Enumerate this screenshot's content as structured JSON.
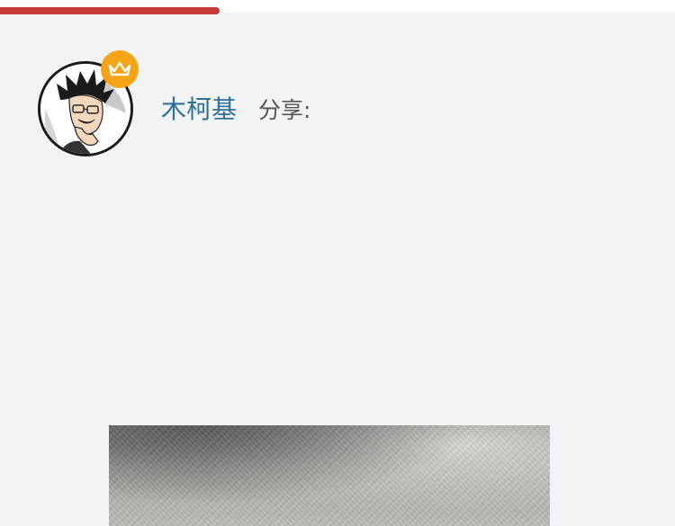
{
  "reading_progress": {
    "fraction": 0.325,
    "color": "#c83a3a"
  },
  "author": {
    "name": "木柯基",
    "share_label": "分享:",
    "name_color": "#2f6f9a",
    "avatar_icon": "manga-portrait-avatar",
    "badge_icon": "crown-icon",
    "badge_color": "#f5a417"
  },
  "content": {
    "image_kind": "grey-textured-photo"
  }
}
